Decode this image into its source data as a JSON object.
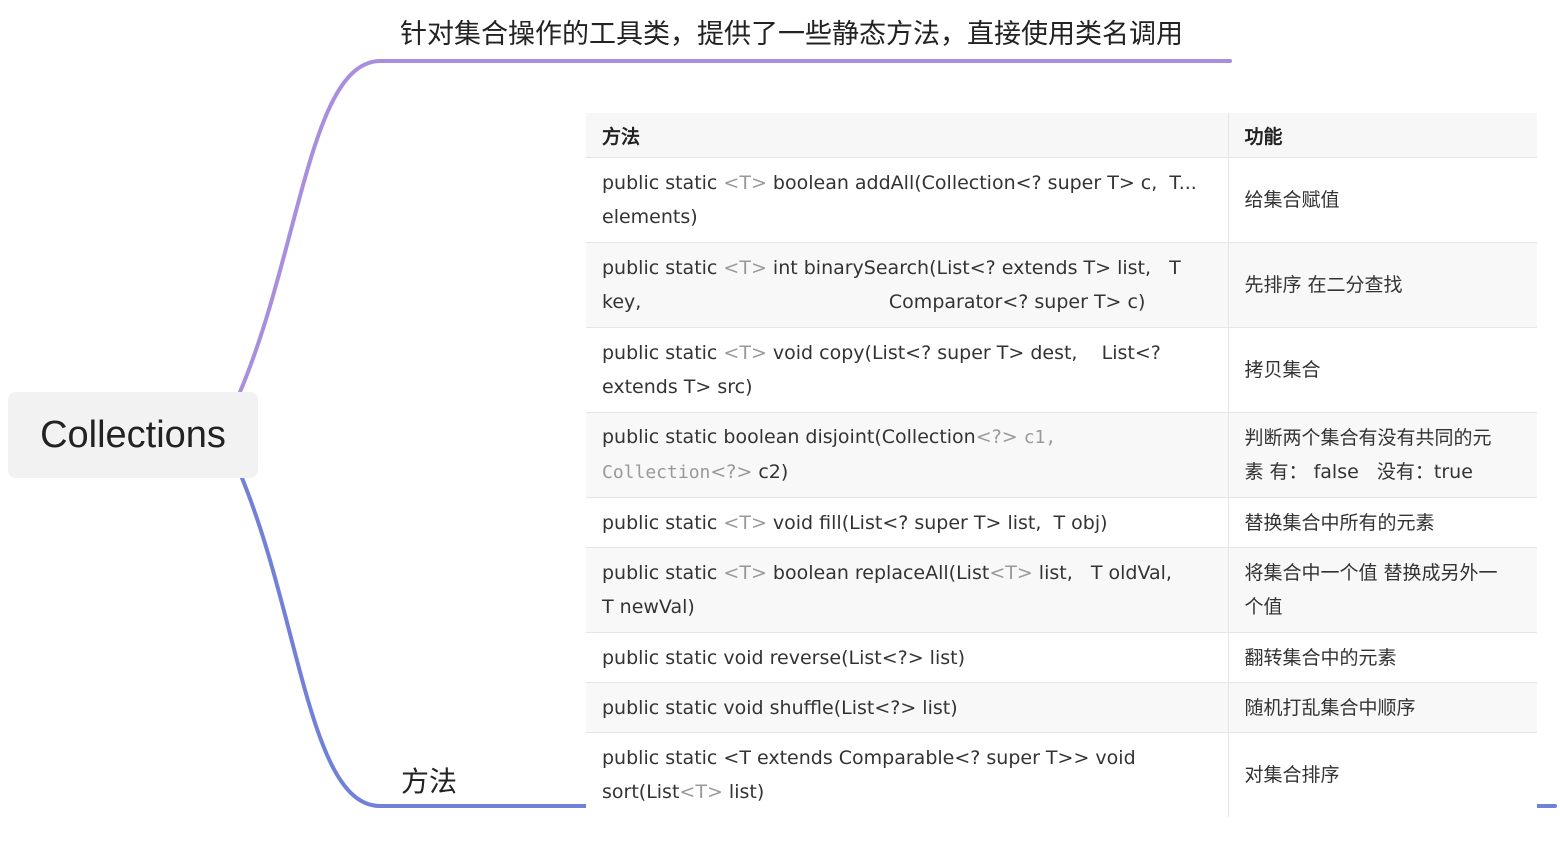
{
  "mindmap": {
    "root": "Collections",
    "branches": [
      {
        "label": "针对集合操作的工具类，提供了一些静态方法，直接使用类名调用",
        "color": "#a98ede"
      },
      {
        "label": "方法",
        "color": "#7281d8"
      }
    ]
  },
  "table": {
    "headers": [
      "方法",
      "功能"
    ],
    "rows": [
      {
        "method_html": "public static <span style=\"color:#999\">&lt;T&gt;</span> boolean addAll(Collection&lt;? super T&gt; c,&nbsp; T...<br>elements)",
        "function": "给集合赋值",
        "lines": 2
      },
      {
        "method_html": "public static <span style=\"color:#999\">&lt;T&gt;</span> int binarySearch(List&lt;? extends T&gt; list,&nbsp;&nbsp; T<br>key,&nbsp;&nbsp;&nbsp;&nbsp;&nbsp;&nbsp;&nbsp;&nbsp;&nbsp;&nbsp;&nbsp;&nbsp;&nbsp;&nbsp;&nbsp;&nbsp;&nbsp;&nbsp;&nbsp;&nbsp;&nbsp;&nbsp;&nbsp;&nbsp;&nbsp;&nbsp;&nbsp;&nbsp;&nbsp;&nbsp;&nbsp;&nbsp;&nbsp;&nbsp;&nbsp;&nbsp;&nbsp;&nbsp;&nbsp;&nbsp; Comparator&lt;? super T&gt; c)",
        "function": "先排序 在二分查找",
        "lines": 2
      },
      {
        "method_html": "public static <span style=\"color:#999\">&lt;T&gt;</span> void copy(List&lt;? super T&gt; dest,&nbsp;&nbsp;&nbsp; List&lt;?<br>extends T&gt; src)",
        "function": "拷贝集合",
        "lines": 2
      },
      {
        "method_html": "public static boolean disjoint(Collection<span style=\"color:#999\">&lt;?&gt;</span> <span class=\"mono\" style=\"color:#999\">c1,</span><br><span class=\"mono\" style=\"color:#999\">Collection</span><span style=\"color:#999\">&lt;?&gt;</span> c2)",
        "function": "判断两个集合有没有共同的元素 有： false&nbsp;&nbsp; 没有：true",
        "function_html": "判断两个集合有没有共同的元<br>素 有： false&nbsp;&nbsp; 没有：true",
        "lines": 2
      },
      {
        "method_html": "public static <span style=\"color:#999\">&lt;T&gt;</span> void fill(List&lt;? super T&gt; list,&nbsp; T obj)",
        "function": "替换集合中所有的元素",
        "lines": 1
      },
      {
        "method_html": "public static <span style=\"color:#999\">&lt;T&gt;</span> boolean replaceAll(List<span style=\"color:#999\">&lt;T&gt;</span> list,&nbsp;&nbsp; T oldVal,<br>T newVal)",
        "function": "将集合中一个值 替换成另外一个值",
        "function_html": "将集合中一个值 替换成另外一<br>个值",
        "lines": 2
      },
      {
        "method_html": "public static void reverse(List&lt;?&gt; list)",
        "function": "翻转集合中的元素",
        "lines": 1
      },
      {
        "method_html": "public static void shuffle(List&lt;?&gt; list)",
        "function": "随机打乱集合中顺序",
        "lines": 1
      },
      {
        "method_html": "public static &lt;T extends Comparable&lt;? super T&gt;&gt; void<br>sort(List<span style=\"color:#999\">&lt;T&gt;</span> list)",
        "function": "对集合排序",
        "lines": 2
      }
    ]
  }
}
